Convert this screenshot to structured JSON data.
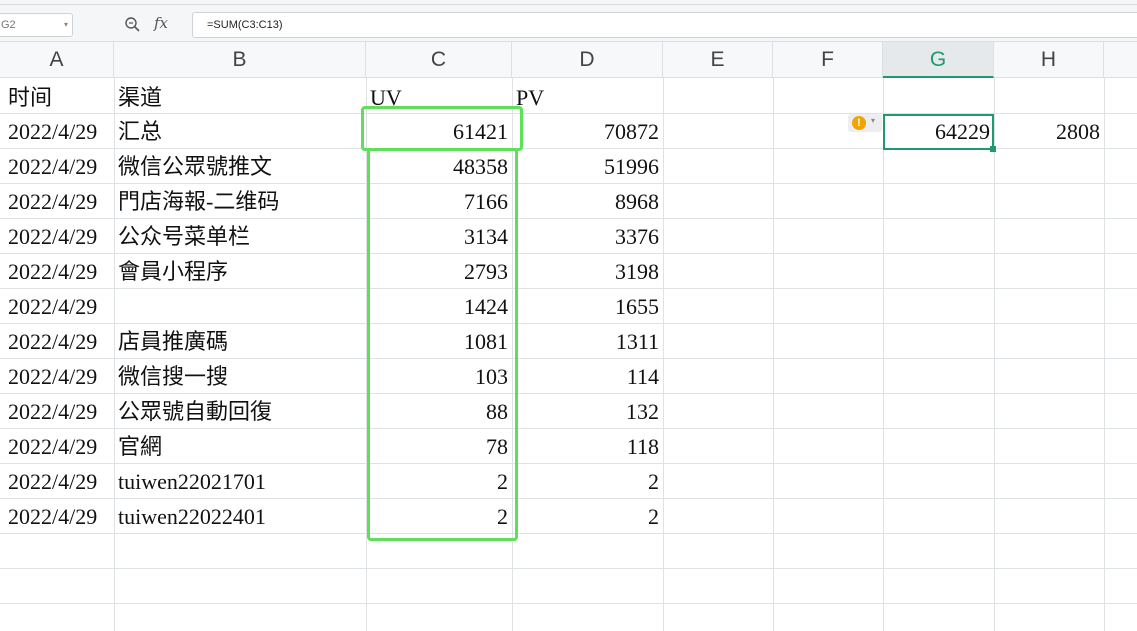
{
  "namebox": {
    "value": "G2"
  },
  "formula_bar": {
    "formula": "=SUM(C3:C13)",
    "fx_label": "fx"
  },
  "columns": [
    "A",
    "B",
    "C",
    "D",
    "E",
    "F",
    "G",
    "H"
  ],
  "active_column": "G",
  "header_row": {
    "a": "时间",
    "b": "渠道",
    "c": "UV",
    "d": "PV"
  },
  "rows": [
    {
      "a": "2022/4/29",
      "b": "汇总",
      "c": "61421",
      "d": "70872"
    },
    {
      "a": "2022/4/29",
      "b": "微信公眾號推文",
      "c": "48358",
      "d": "51996"
    },
    {
      "a": "2022/4/29",
      "b": "門店海報-二维码",
      "c": "7166",
      "d": "8968"
    },
    {
      "a": "2022/4/29",
      "b": "公众号菜单栏",
      "c": "3134",
      "d": "3376"
    },
    {
      "a": "2022/4/29",
      "b": "會員小程序",
      "c": "2793",
      "d": "3198"
    },
    {
      "a": "2022/4/29",
      "b": "",
      "c": "1424",
      "d": "1655"
    },
    {
      "a": "2022/4/29",
      "b": "店員推廣碼",
      "c": "1081",
      "d": "1311"
    },
    {
      "a": "2022/4/29",
      "b": "微信搜一搜",
      "c": "103",
      "d": "114"
    },
    {
      "a": "2022/4/29",
      "b": "公眾號自動回復",
      "c": "88",
      "d": "132"
    },
    {
      "a": "2022/4/29",
      "b": "官網",
      "c": "78",
      "d": "118"
    },
    {
      "a": "2022/4/29",
      "b": "tuiwen22021701",
      "c": "2",
      "d": "2"
    },
    {
      "a": "2022/4/29",
      "b": "tuiwen22022401",
      "c": "2",
      "d": "2"
    }
  ],
  "g2_value": "64229",
  "h2_value": "2808",
  "warning_icon": "exclamation-icon",
  "highlight_color": "#5fe05a",
  "selection_color": "#1e9b6a"
}
